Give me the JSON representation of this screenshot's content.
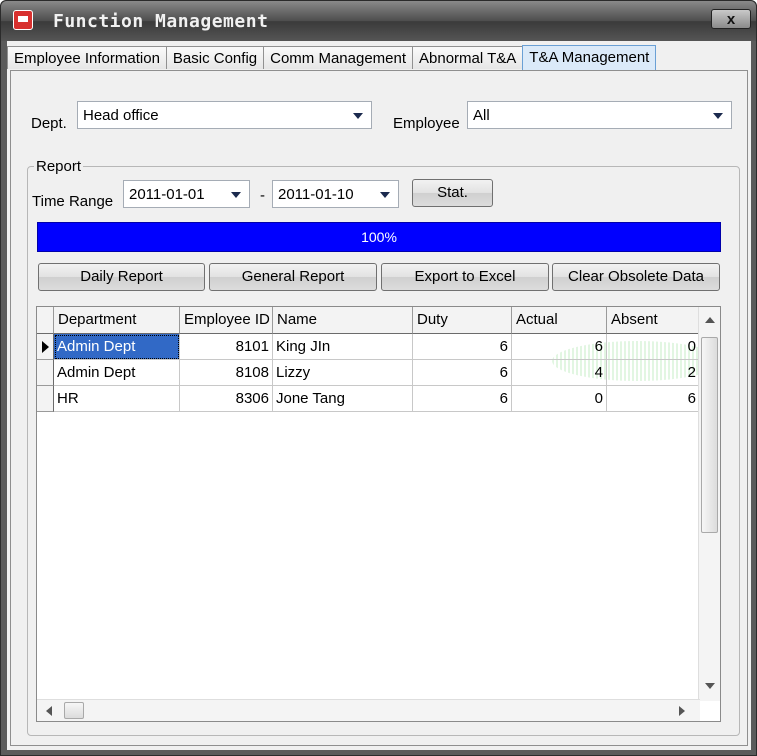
{
  "window": {
    "title": "Function Management",
    "close_label": "x"
  },
  "tabs": [
    {
      "label": "Employee Information",
      "active": false
    },
    {
      "label": "Basic Config",
      "active": false
    },
    {
      "label": "Comm Management",
      "active": false
    },
    {
      "label": "Abnormal T&A",
      "active": false
    },
    {
      "label": "T&A Management",
      "active": true
    }
  ],
  "filters": {
    "dept_label": "Dept.",
    "dept_value": "Head office",
    "employee_label": "Employee",
    "employee_value": "All"
  },
  "report": {
    "group_title": "Report",
    "time_range_label": "Time Range",
    "start_date": "2011-01-01",
    "separator": "-",
    "end_date": "2011-01-10",
    "stat_button": "Stat.",
    "progress_text": "100%",
    "progress_value": 1.0,
    "buttons": {
      "daily": "Daily Report",
      "general": "General Report",
      "export": "Export to Excel",
      "clear": "Clear Obsolete Data"
    }
  },
  "table": {
    "columns": [
      "Department",
      "Employee ID",
      "Name",
      "Duty",
      "Actual",
      "Absent"
    ],
    "rows": [
      {
        "department": "Admin Dept",
        "employee_id": "8101",
        "name": "King JIn",
        "duty": "6",
        "actual": "6",
        "absent": "0",
        "selected": true
      },
      {
        "department": "Admin Dept",
        "employee_id": "8108",
        "name": "Lizzy",
        "duty": "6",
        "actual": "4",
        "absent": "2",
        "selected": false
      },
      {
        "department": "HR",
        "employee_id": "8306",
        "name": "Jone Tang",
        "duty": "6",
        "actual": "0",
        "absent": "6",
        "selected": false
      }
    ]
  },
  "colors": {
    "progress": "#0000ff",
    "selection": "#3169c6",
    "title_bar": "#4d4d4d"
  }
}
